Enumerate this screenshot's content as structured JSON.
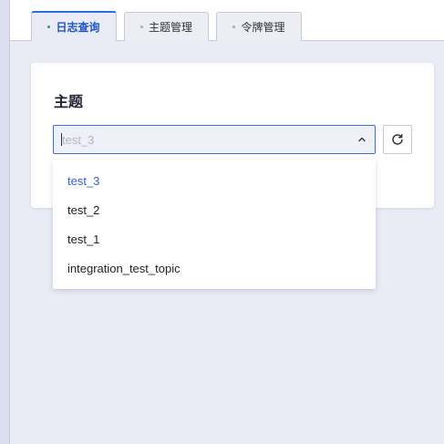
{
  "tabs": [
    {
      "label": "日志查询",
      "active": true
    },
    {
      "label": "主题管理",
      "active": false
    },
    {
      "label": "令牌管理",
      "active": false
    }
  ],
  "topic": {
    "title": "主题",
    "select_placeholder": "test_3",
    "options": [
      {
        "label": "test_3",
        "selected": true
      },
      {
        "label": "test_2",
        "selected": false
      },
      {
        "label": "test_1",
        "selected": false
      },
      {
        "label": "integration_test_topic",
        "selected": false
      }
    ]
  },
  "colors": {
    "accent": "#2b6de8",
    "selected_option": "#2f5fd0",
    "active_dot": "#2f9a8e",
    "page_bg": "#e9ebf5"
  },
  "icons": {
    "select_arrow": "chevron-up-icon",
    "refresh": "refresh-icon"
  }
}
